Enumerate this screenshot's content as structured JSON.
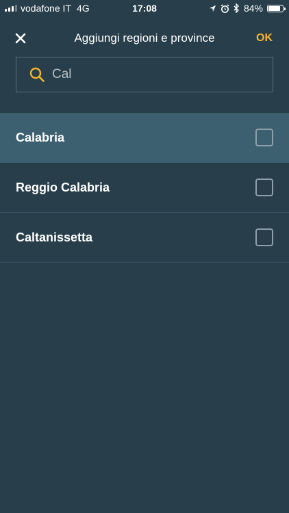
{
  "status_bar": {
    "carrier": "vodafone IT",
    "network": "4G",
    "time": "17:08",
    "battery_percent": "84%",
    "battery_level": 0.84,
    "icons": [
      "signal-icon",
      "location-arrow-icon",
      "alarm-icon",
      "bluetooth-icon",
      "battery-icon"
    ]
  },
  "header": {
    "close_icon": "close-icon",
    "title": "Aggiungi regioni e province",
    "ok_label": "OK"
  },
  "search": {
    "icon": "search-icon",
    "value": "Cal"
  },
  "results": [
    {
      "label": "Calabria",
      "selected": true,
      "checked": false
    },
    {
      "label": "Reggio Calabria",
      "selected": false,
      "checked": false
    },
    {
      "label": "Caltanissetta",
      "selected": false,
      "checked": false
    }
  ],
  "colors": {
    "background": "#283f4b",
    "selected_row": "#3d6070",
    "accent": "#f5b52a",
    "divider": "#3a5461"
  }
}
